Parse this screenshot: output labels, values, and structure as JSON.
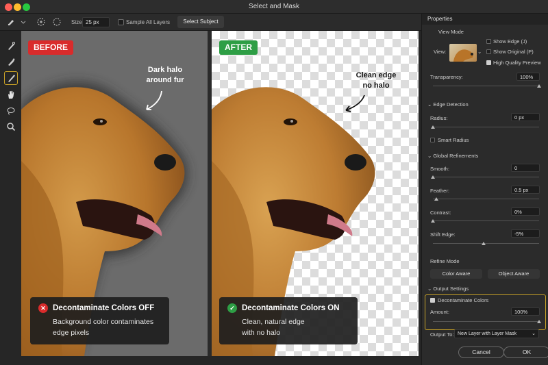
{
  "window": {
    "title": "Select and Mask"
  },
  "options_bar": {
    "size_label": "Size:",
    "size_value": "25 px",
    "sample_all_layers_label": "Sample All Layers",
    "sample_all_layers_checked": false,
    "select_subject_label": "Select Subject"
  },
  "toolbar": {
    "tools": [
      "quick-selection-icon",
      "refine-edge-brush-icon",
      "brush-icon",
      "object-selection-icon",
      "hand-icon",
      "lasso-icon",
      "zoom-icon"
    ],
    "active_tool": "object-selection-icon"
  },
  "before": {
    "badge": "BEFORE",
    "badge_color": "#d92b2b",
    "annotation_line1": "Dark halo",
    "annotation_line2": "around fur",
    "caption_title": "Decontaminate Colors OFF",
    "caption_line1": "Background color contaminates",
    "caption_line2": "edge pixels"
  },
  "after": {
    "badge": "AFTER",
    "badge_color": "#2e9e45",
    "annotation_line1": "Clean edge",
    "annotation_line2": "no halo",
    "caption_title": "Decontaminate Colors ON",
    "caption_line1": "Clean, natural edge",
    "caption_line2": "with no halo"
  },
  "properties": {
    "tab": "Properties",
    "view_mode": {
      "header": "View Mode",
      "view_label": "View:",
      "show_edge": "Show Edge (J)",
      "show_original": "Show Original (P)",
      "high_quality_preview": "High Quality Preview",
      "high_quality_checked": true
    },
    "transparency": {
      "label": "Transparency:",
      "value": "100%",
      "level": 1.0
    },
    "edge_detection": {
      "header": "Edge Detection",
      "radius_label": "Radius:",
      "radius_value": "0 px",
      "radius_level": 0.0,
      "smart_radius": "Smart Radius"
    },
    "global_refinements": {
      "header": "Global Refinements",
      "smooth_label": "Smooth:",
      "smooth_value": "0",
      "smooth_level": 0.0,
      "feather_label": "Feather:",
      "feather_value": "0.5 px",
      "feather_level": 0.03,
      "contrast_label": "Contrast:",
      "contrast_value": "0%",
      "contrast_level": 0.0,
      "shift_edge_label": "Shift Edge:",
      "shift_edge_value": "-5%",
      "shift_edge_level": 0.475
    },
    "refine_mode": {
      "header": "Refine Mode",
      "color_aware": "Color Aware",
      "object_aware": "Object Aware"
    },
    "output_settings": {
      "header": "Output Settings",
      "decontaminate": "Decontaminate Colors",
      "decontaminate_checked": true,
      "amount_label": "Amount:",
      "amount_value": "100%",
      "amount_level": 1.0,
      "output_to_label": "Output To:",
      "output_to_value": "New Layer with Layer Mask"
    },
    "cancel": "Cancel",
    "ok": "OK"
  }
}
